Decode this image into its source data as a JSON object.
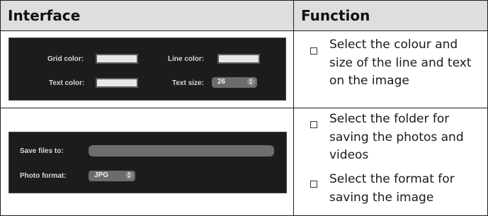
{
  "table": {
    "headers": {
      "interface": "Interface",
      "function": "Function"
    }
  },
  "row1": {
    "grid_color_label": "Grid color:",
    "line_color_label": "Line color:",
    "text_color_label": "Text color:",
    "text_size_label": "Text size:",
    "text_size_value": "26",
    "swatch_color": "#e7e7e7",
    "bullets": [
      "Select the colour and size of the line and text on the image"
    ]
  },
  "row2": {
    "save_files_label": "Save files to:",
    "save_files_value": "",
    "photo_format_label": "Photo format:",
    "photo_format_value": "JPG",
    "bullets": [
      "Select the folder for saving the photos and videos",
      "Select the format for saving the image"
    ]
  },
  "icons": {
    "bullet": "empty-square-bullet-icon",
    "stepper": "up-down-arrows-icon"
  }
}
